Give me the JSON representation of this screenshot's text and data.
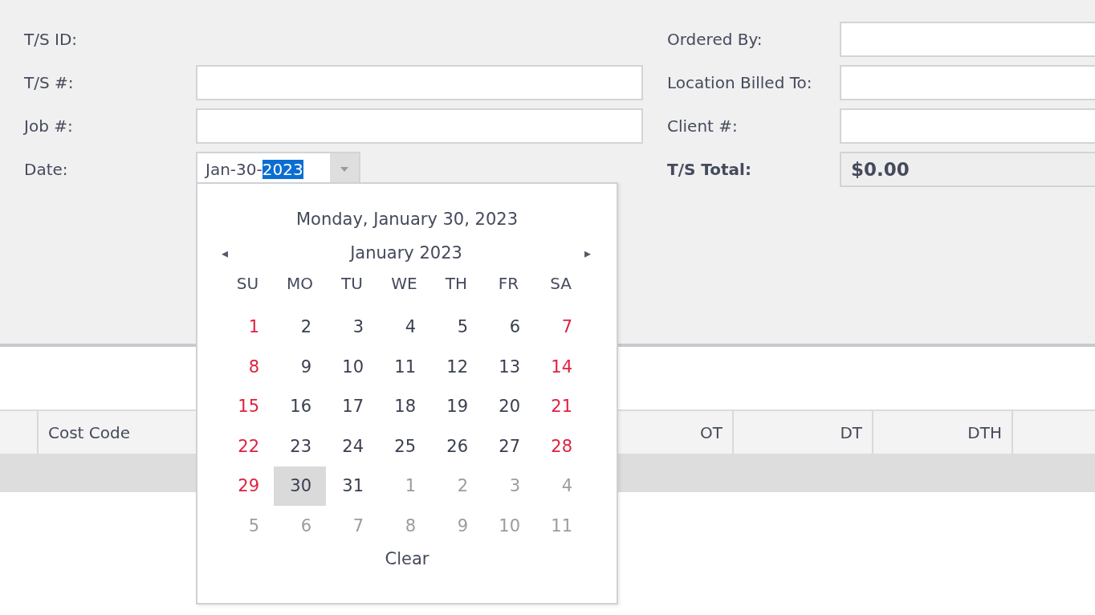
{
  "form": {
    "left": [
      {
        "label": "T/S ID:",
        "kind": "text"
      },
      {
        "label": "T/S #:",
        "kind": "field"
      },
      {
        "label": "Job #:",
        "kind": "field"
      },
      {
        "label": "Date:",
        "kind": "date",
        "value": "Jan-30-",
        "selected_text": "2023"
      }
    ],
    "right": [
      {
        "label": "Ordered By:",
        "kind": "field"
      },
      {
        "label": "Location Billed To:",
        "kind": "field"
      },
      {
        "label": "Client #:",
        "kind": "field"
      },
      {
        "label": "T/S Total:",
        "kind": "total",
        "value": "$0.00"
      }
    ]
  },
  "calendar": {
    "today_text": "Monday, January 30, 2023",
    "month": "January 2023",
    "prev": "◂",
    "next": "▸",
    "weekdays": [
      "SU",
      "MO",
      "TU",
      "WE",
      "TH",
      "FR",
      "SA"
    ],
    "days": [
      {
        "label": "1",
        "kind": "weekend",
        "selected": false
      },
      {
        "label": "2",
        "kind": "weekday",
        "selected": false
      },
      {
        "label": "3",
        "kind": "weekday",
        "selected": false
      },
      {
        "label": "4",
        "kind": "weekday",
        "selected": false
      },
      {
        "label": "5",
        "kind": "weekday",
        "selected": false
      },
      {
        "label": "6",
        "kind": "weekday",
        "selected": false
      },
      {
        "label": "7",
        "kind": "weekend",
        "selected": false
      },
      {
        "label": "8",
        "kind": "weekend",
        "selected": false
      },
      {
        "label": "9",
        "kind": "weekday",
        "selected": false
      },
      {
        "label": "10",
        "kind": "weekday",
        "selected": false
      },
      {
        "label": "11",
        "kind": "weekday",
        "selected": false
      },
      {
        "label": "12",
        "kind": "weekday",
        "selected": false
      },
      {
        "label": "13",
        "kind": "weekday",
        "selected": false
      },
      {
        "label": "14",
        "kind": "weekend",
        "selected": false
      },
      {
        "label": "15",
        "kind": "weekend",
        "selected": false
      },
      {
        "label": "16",
        "kind": "weekday",
        "selected": false
      },
      {
        "label": "17",
        "kind": "weekday",
        "selected": false
      },
      {
        "label": "18",
        "kind": "weekday",
        "selected": false
      },
      {
        "label": "19",
        "kind": "weekday",
        "selected": false
      },
      {
        "label": "20",
        "kind": "weekday",
        "selected": false
      },
      {
        "label": "21",
        "kind": "weekend",
        "selected": false
      },
      {
        "label": "22",
        "kind": "weekend",
        "selected": false
      },
      {
        "label": "23",
        "kind": "weekday",
        "selected": false
      },
      {
        "label": "24",
        "kind": "weekday",
        "selected": false
      },
      {
        "label": "25",
        "kind": "weekday",
        "selected": false
      },
      {
        "label": "26",
        "kind": "weekday",
        "selected": false
      },
      {
        "label": "27",
        "kind": "weekday",
        "selected": false
      },
      {
        "label": "28",
        "kind": "weekend",
        "selected": false
      },
      {
        "label": "29",
        "kind": "weekend",
        "selected": false
      },
      {
        "label": "30",
        "kind": "weekday",
        "selected": true
      },
      {
        "label": "31",
        "kind": "weekday",
        "selected": false
      },
      {
        "label": "1",
        "kind": "other",
        "selected": false
      },
      {
        "label": "2",
        "kind": "other",
        "selected": false
      },
      {
        "label": "3",
        "kind": "other",
        "selected": false
      },
      {
        "label": "4",
        "kind": "other",
        "selected": false
      },
      {
        "label": "5",
        "kind": "other",
        "selected": false
      },
      {
        "label": "6",
        "kind": "other",
        "selected": false
      },
      {
        "label": "7",
        "kind": "other",
        "selected": false
      },
      {
        "label": "8",
        "kind": "other",
        "selected": false
      },
      {
        "label": "9",
        "kind": "other",
        "selected": false
      },
      {
        "label": "10",
        "kind": "other",
        "selected": false
      },
      {
        "label": "11",
        "kind": "other",
        "selected": false
      }
    ],
    "clear": "Clear"
  },
  "grid": {
    "columns": [
      {
        "label": "Cost Code",
        "kind": "text"
      },
      {
        "label": "OT",
        "kind": "number"
      },
      {
        "label": "DT",
        "kind": "number"
      },
      {
        "label": "DTH",
        "kind": "number"
      }
    ]
  }
}
